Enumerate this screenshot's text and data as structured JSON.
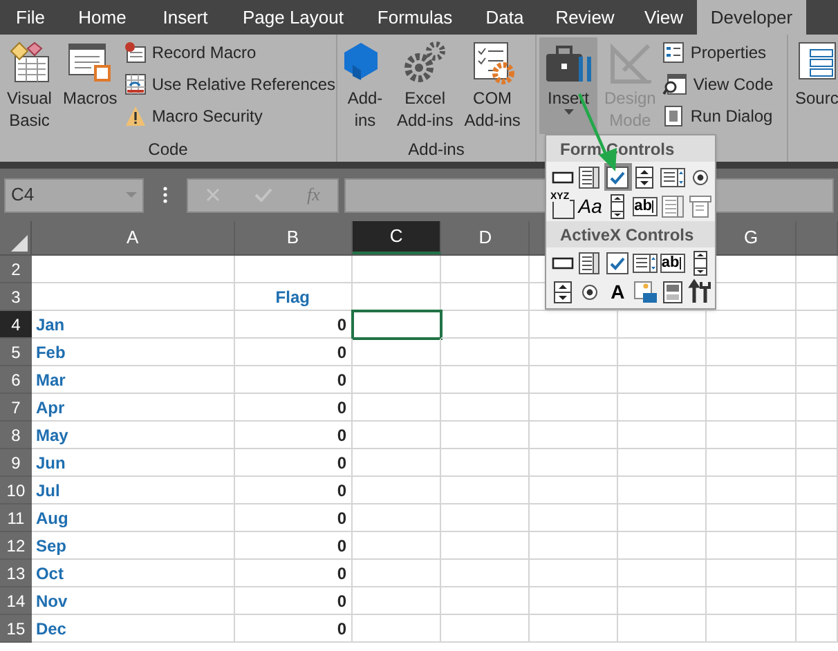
{
  "tabs": [
    {
      "label": "File",
      "selected": false
    },
    {
      "label": "Home",
      "selected": false
    },
    {
      "label": "Insert",
      "selected": false
    },
    {
      "label": "Page Layout",
      "selected": false
    },
    {
      "label": "Formulas",
      "selected": false
    },
    {
      "label": "Data",
      "selected": false
    },
    {
      "label": "Review",
      "selected": false
    },
    {
      "label": "View",
      "selected": false
    },
    {
      "label": "Developer",
      "selected": true
    }
  ],
  "ribbon": {
    "groups": [
      {
        "label": "Code",
        "large": [
          {
            "kind": "vba",
            "lines": [
              "Visual",
              "Basic"
            ]
          },
          {
            "kind": "macros",
            "lines": [
              "Macros"
            ]
          }
        ],
        "small": [
          {
            "kind": "record",
            "label": "Record Macro"
          },
          {
            "kind": "relative",
            "label": "Use Relative References"
          },
          {
            "kind": "security",
            "label": "Macro Security"
          }
        ]
      },
      {
        "label": "Add-ins",
        "large": [
          {
            "kind": "addins",
            "lines": [
              "Add-",
              "ins"
            ]
          },
          {
            "kind": "excel-addins",
            "lines": [
              "Excel",
              "Add-ins"
            ]
          },
          {
            "kind": "com-addins",
            "lines": [
              "COM",
              "Add-ins"
            ]
          }
        ]
      },
      {
        "large": [
          {
            "kind": "insert",
            "lines": [
              "Insert"
            ],
            "expanded": true,
            "disabled": false
          },
          {
            "kind": "design",
            "lines": [
              "Design",
              "Mode"
            ],
            "disabled": true
          }
        ],
        "small": [
          {
            "kind": "properties",
            "label": "Properties"
          },
          {
            "kind": "view-code",
            "label": "View Code"
          },
          {
            "kind": "run-dialog",
            "label": "Run Dialog"
          }
        ]
      },
      {
        "large": [
          {
            "kind": "source",
            "lines": [
              "Sourc"
            ]
          }
        ]
      }
    ]
  },
  "formula_bar": {
    "name_box": "C4",
    "fx": "fx"
  },
  "popup": {
    "sections": [
      {
        "title": "Form Controls",
        "controls": [
          {
            "kind": "button",
            "selected": false
          },
          {
            "kind": "combo",
            "selected": false
          },
          {
            "kind": "checkbox",
            "selected": true
          },
          {
            "kind": "spin",
            "selected": false
          },
          {
            "kind": "listbox",
            "selected": false
          },
          {
            "kind": "option",
            "selected": false
          },
          {
            "kind": "groupbox",
            "glyph": "XYZ",
            "selected": false
          },
          {
            "kind": "label",
            "glyph": "Aa",
            "selected": false
          },
          {
            "kind": "scrollbar",
            "selected": false
          },
          {
            "kind": "textfield",
            "glyph": "ab",
            "selected": false
          },
          {
            "kind": "combolist",
            "selected": false
          },
          {
            "kind": "combodrop",
            "selected": false
          }
        ]
      },
      {
        "title": "ActiveX Controls",
        "controls": [
          {
            "kind": "button",
            "selected": false
          },
          {
            "kind": "combo",
            "selected": false
          },
          {
            "kind": "checkbox",
            "selected": false
          },
          {
            "kind": "listbox",
            "selected": false
          },
          {
            "kind": "textfield",
            "glyph": "ab",
            "selected": false
          },
          {
            "kind": "scrollbar",
            "selected": false
          },
          {
            "kind": "spin",
            "selected": false
          },
          {
            "kind": "option",
            "selected": false
          },
          {
            "kind": "label",
            "glyph": "A",
            "selected": false
          },
          {
            "kind": "image",
            "selected": false
          },
          {
            "kind": "toggle",
            "selected": false
          },
          {
            "kind": "more",
            "selected": false
          }
        ]
      }
    ]
  },
  "columns": [
    {
      "label": "A",
      "selected": false
    },
    {
      "label": "B",
      "selected": false
    },
    {
      "label": "C",
      "selected": true
    },
    {
      "label": "D",
      "selected": false
    },
    {},
    {},
    {
      "label": "G",
      "selected": false
    },
    {
      "selected": false
    }
  ],
  "rows": [
    {
      "number": "2",
      "selected": false
    },
    {
      "number": "3",
      "selected": false,
      "heading": "Flag"
    },
    {
      "number": "4",
      "selected": true,
      "month": "Jan",
      "flag": "0"
    },
    {
      "number": "5",
      "selected": false,
      "month": "Feb",
      "flag": "0"
    },
    {
      "number": "6",
      "selected": false,
      "month": "Mar",
      "flag": "0"
    },
    {
      "number": "7",
      "selected": false,
      "month": "Apr",
      "flag": "0"
    },
    {
      "number": "8",
      "selected": false,
      "month": "May",
      "flag": "0"
    },
    {
      "number": "9",
      "selected": false,
      "month": "Jun",
      "flag": "0"
    },
    {
      "number": "10",
      "selected": false,
      "month": "Jul",
      "flag": "0"
    },
    {
      "number": "11",
      "selected": false,
      "month": "Aug",
      "flag": "0"
    },
    {
      "number": "12",
      "selected": false,
      "month": "Sep",
      "flag": "0"
    },
    {
      "number": "13",
      "selected": false,
      "month": "Oct",
      "flag": "0"
    },
    {
      "number": "14",
      "selected": false,
      "month": "Nov",
      "flag": "0"
    },
    {
      "number": "15",
      "selected": false,
      "month": "Dec",
      "flag": "0"
    }
  ]
}
